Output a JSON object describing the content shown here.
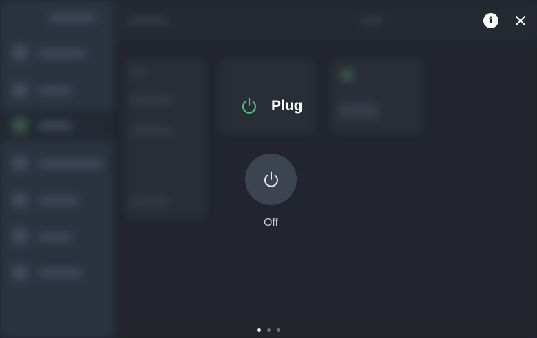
{
  "dialog": {
    "title": "Plug",
    "state_label": "Off",
    "accent_color": "#4fbf7a",
    "icons": {
      "title": "power-icon",
      "toggle": "power-icon",
      "info": "info-icon",
      "close": "close-icon"
    },
    "info_glyph": "i"
  },
  "pager": {
    "pages": [
      {
        "active": true
      },
      {
        "active": false
      },
      {
        "active": false
      }
    ]
  }
}
